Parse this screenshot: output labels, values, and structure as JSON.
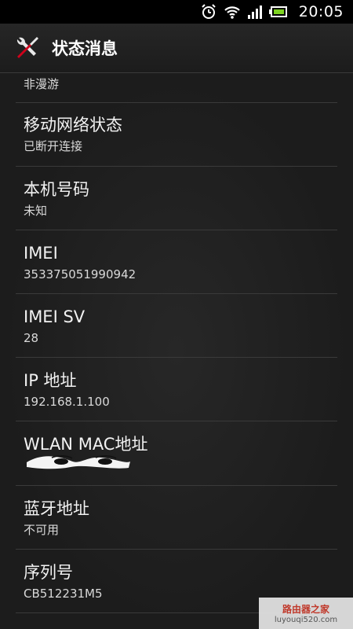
{
  "status_bar": {
    "time": "20:05",
    "icons": [
      "alarm-icon",
      "wifi-icon",
      "signal-icon",
      "battery-icon"
    ]
  },
  "title_bar": {
    "title": "状态消息",
    "icon": "tools-icon"
  },
  "items": [
    {
      "label": "",
      "value": "非漫游"
    },
    {
      "label": "移动网络状态",
      "value": "已断开连接"
    },
    {
      "label": "本机号码",
      "value": "未知"
    },
    {
      "label": "IMEI",
      "value": "353375051990942"
    },
    {
      "label": "IMEI SV",
      "value": "28"
    },
    {
      "label": "IP 地址",
      "value": "192.168.1.100"
    },
    {
      "label": "WLAN MAC地址",
      "value": ""
    },
    {
      "label": "蓝牙地址",
      "value": "不可用"
    },
    {
      "label": "序列号",
      "value": "CB512231M5"
    }
  ],
  "watermark": {
    "name": "路由器之家",
    "url": "luyouqi520.com"
  },
  "colors": {
    "background": "#1c1c1c",
    "divider": "#3a3a3a",
    "text": "#ffffff"
  }
}
